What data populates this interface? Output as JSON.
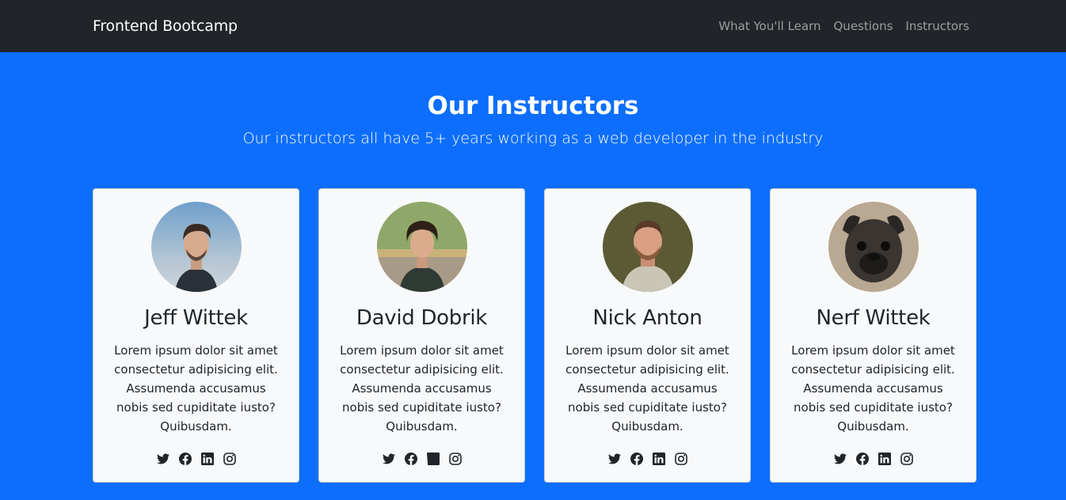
{
  "navbar": {
    "brand": "Frontend Bootcamp",
    "links": [
      "What You'll Learn",
      "Questions",
      "Instructors"
    ]
  },
  "section": {
    "title": "Our Instructors",
    "subtitle": "Our instructors all have 5+ years working as a web developer in the industry"
  },
  "cards": [
    {
      "name": "Jeff Wittek",
      "text": "Lorem ipsum dolor sit amet consectetur adipisicing elit. Assumenda accusamus nobis sed cupiditate iusto? Quibusdam."
    },
    {
      "name": "David Dobrik",
      "text": "Lorem ipsum dolor sit amet consectetur adipisicing elit. Assumenda accusamus nobis sed cupiditate iusto? Quibusdam."
    },
    {
      "name": "Nick Anton",
      "text": "Lorem ipsum dolor sit amet consectetur adipisicing elit. Assumenda accusamus nobis sed cupiditate iusto? Quibusdam."
    },
    {
      "name": "Nerf Wittek",
      "text": "Lorem ipsum dolor sit amet consectetur adipisicing elit. Assumenda accusamus nobis sed cupiditate iusto? Quibusdam."
    }
  ],
  "social_icons": [
    "twitter-icon",
    "facebook-icon",
    "linkedin-icon",
    "instagram-icon"
  ],
  "colors": {
    "navbar": "#212529",
    "section": "#0d6efd",
    "card": "#f8f9fa",
    "text": "#212529"
  }
}
